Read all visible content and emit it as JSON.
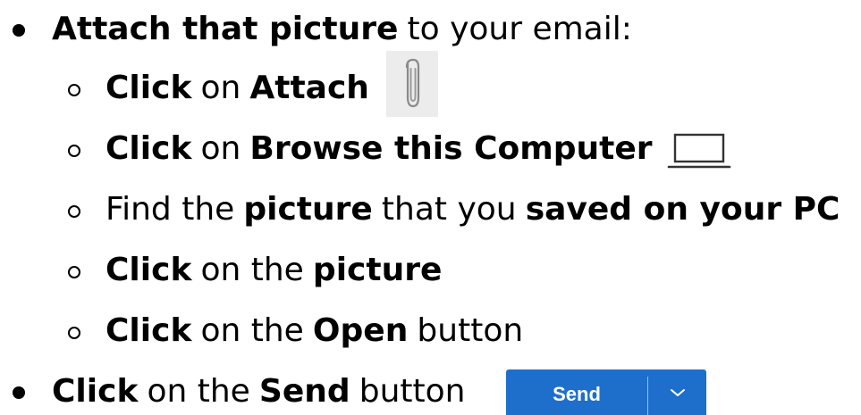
{
  "instructions": [
    {
      "level": 1,
      "segments": [
        {
          "text": "Attach that picture",
          "bold": true
        },
        {
          "text": "to your email:",
          "bold": false
        }
      ]
    },
    {
      "level": 2,
      "segments": [
        {
          "text": "Click",
          "bold": true
        },
        {
          "text": "on",
          "bold": false
        },
        {
          "text": "Attach",
          "bold": true
        }
      ],
      "icon": "paperclip-icon"
    },
    {
      "level": 2,
      "segments": [
        {
          "text": "Click",
          "bold": true
        },
        {
          "text": "on",
          "bold": false
        },
        {
          "text": "Browse this Computer",
          "bold": true
        }
      ],
      "icon": "laptop-icon"
    },
    {
      "level": 2,
      "segments": [
        {
          "text": "Find the",
          "bold": false
        },
        {
          "text": "picture",
          "bold": true
        },
        {
          "text": "that you",
          "bold": false
        },
        {
          "text": "saved on your PC",
          "bold": true
        }
      ]
    },
    {
      "level": 2,
      "segments": [
        {
          "text": "Click",
          "bold": true
        },
        {
          "text": "on the",
          "bold": false
        },
        {
          "text": "picture",
          "bold": true
        }
      ]
    },
    {
      "level": 2,
      "segments": [
        {
          "text": "Click",
          "bold": true
        },
        {
          "text": "on the",
          "bold": false
        },
        {
          "text": "Open",
          "bold": true
        },
        {
          "text": "button",
          "bold": false
        }
      ]
    },
    {
      "level": 1,
      "segments": [
        {
          "text": "Click",
          "bold": true
        },
        {
          "text": "on the",
          "bold": false
        },
        {
          "text": "Send",
          "bold": true
        },
        {
          "text": "button",
          "bold": false
        }
      ],
      "icon": "send-button"
    }
  ],
  "send_button": {
    "label": "Send",
    "color": "#1e6fcc",
    "dropdown_icon": "chevron-down-icon"
  },
  "icons": {
    "attach": "paperclip-icon",
    "browse": "laptop-icon"
  }
}
